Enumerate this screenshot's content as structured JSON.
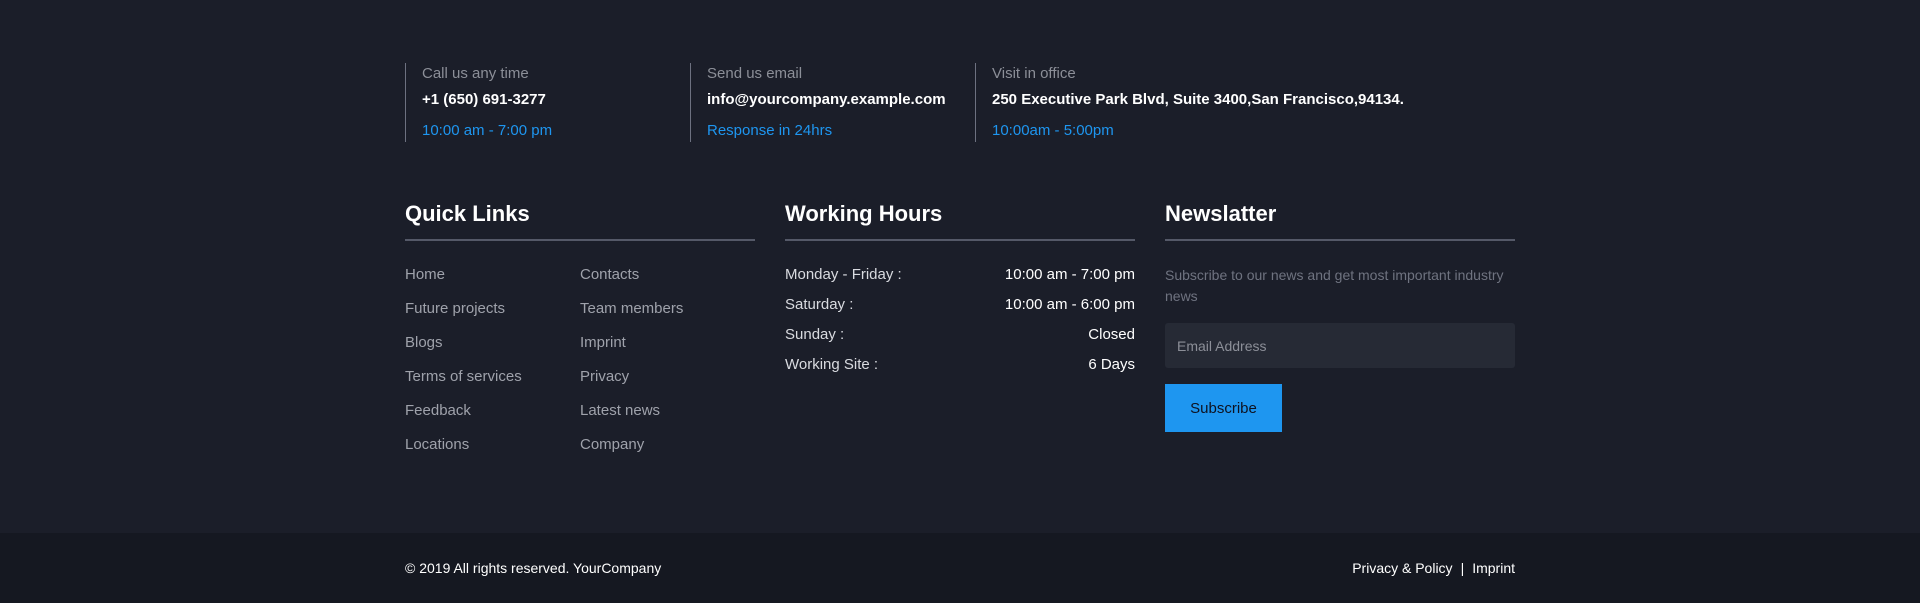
{
  "contact": {
    "phone": {
      "title": "Call us any time",
      "value": "+1 (650) 691-3277",
      "sub": "10:00 am - 7:00 pm"
    },
    "email": {
      "title": "Send us email",
      "value": "info@yourcompany.example.com",
      "sub": "Response in 24hrs"
    },
    "office": {
      "title": "Visit in office",
      "value": "250 Executive Park Blvd, Suite 3400,San Francisco,94134.",
      "sub": "10:00am - 5:00pm"
    }
  },
  "quick_links": {
    "title": "Quick Links",
    "items": [
      "Home",
      "Contacts",
      "Future projects",
      "Team members",
      "Blogs",
      "Imprint",
      "Terms of services",
      "Privacy",
      "Feedback",
      "Latest news",
      "Locations",
      "Company"
    ]
  },
  "working_hours": {
    "title": "Working Hours",
    "rows": [
      {
        "day": "Monday - Friday :",
        "time": "10:00 am - 7:00 pm"
      },
      {
        "day": "Saturday :",
        "time": "10:00 am - 6:00 pm"
      },
      {
        "day": "Sunday :",
        "time": "Closed"
      },
      {
        "day": "Working Site :",
        "time": "6 Days"
      }
    ]
  },
  "newsletter": {
    "title": "Newslatter",
    "description": "Subscribe to our news and get most important industry news",
    "placeholder": "Email Address",
    "button_label": "Subscribe"
  },
  "bottom": {
    "copyright": "© 2019 All rights reserved. YourCompany",
    "privacy_label": "Privacy & Policy",
    "separator": "|",
    "imprint_label": "Imprint"
  },
  "colors": {
    "background": "#1b1e29",
    "bottom_bar": "#151821",
    "accent": "#1e96f0"
  }
}
